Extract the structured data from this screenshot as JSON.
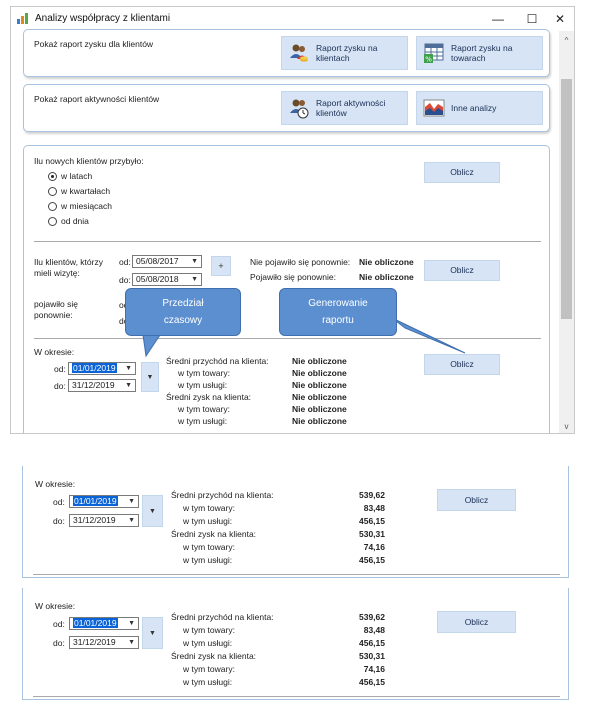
{
  "window": {
    "title": "Analizy współpracy z klientami",
    "min_glyph": "—",
    "max_glyph": "☐",
    "close_glyph": "✕"
  },
  "profit_panel": {
    "label": "Pokaż raport zysku dla klientów",
    "btn_clients_l1": "Raport zysku na",
    "btn_clients_l2": "klientach",
    "btn_goods_l1": "Raport zysku na",
    "btn_goods_l2": "towarach"
  },
  "activity_panel": {
    "label": "Pokaż raport aktywności klientów",
    "btn_activity_l1": "Raport aktywności",
    "btn_activity_l2": "klientów",
    "btn_other": "Inne analizy"
  },
  "new_clients": {
    "question": "Ilu nowych klientów przybyło:",
    "options": [
      "w latach",
      "w kwartałach",
      "w miesiącach",
      "od dnia"
    ],
    "selected_index": 0,
    "calc_label": "Oblicz"
  },
  "visits": {
    "question_l1": "Ilu klientów, którzy",
    "question_l2": "mieli wizytę:",
    "from_label": "od:",
    "from_value": "05/08/2017",
    "to_label": "do:",
    "to_value": "05/08/2018",
    "plus": "+",
    "not_returned_label": "Nie pojawiło się ponownie:",
    "not_returned_value": "Nie obliczone",
    "returned_label": "Pojawiło się ponownie:",
    "returned_value": "Nie obliczone",
    "calc_label": "Oblicz",
    "appeared_l1": "pojawiło się",
    "appeared_l2": "ponownie:",
    "hidden_from_frag": "od",
    "hidden_to_frag": "do"
  },
  "period_top": {
    "label": "W okresie:",
    "from_label": "od:",
    "from_value": "01/01/2019",
    "to_label": "do:",
    "to_value": "31/12/2019",
    "calc_label": "Oblicz",
    "rows": [
      {
        "label": "Średni przychód na klienta:",
        "value": "Nie obliczone"
      },
      {
        "label": "w tym towary:",
        "value": "Nie obliczone"
      },
      {
        "label": "w tym usługi:",
        "value": "Nie obliczone"
      },
      {
        "label": "Średni zysk na klienta:",
        "value": "Nie obliczone"
      },
      {
        "label": "w tym towary:",
        "value": "Nie obliczone"
      },
      {
        "label": "w tym usługi:",
        "value": "Nie obliczone"
      }
    ]
  },
  "callouts": {
    "range_l1": "Przedział",
    "range_l2": "czasowy",
    "gen_l1": "Generowanie",
    "gen_l2": "raportu"
  },
  "period_crop_1": {
    "label": "W okresie:",
    "from_label": "od:",
    "from_value": "01/01/2019",
    "to_label": "do:",
    "to_value": "31/12/2019",
    "calc_label": "Oblicz",
    "rows": [
      {
        "label": "Średni przychód na klienta:",
        "value": "539,62"
      },
      {
        "label": "w tym towary:",
        "value": "83,48"
      },
      {
        "label": "w tym usługi:",
        "value": "456,15"
      },
      {
        "label": "Średni zysk na klienta:",
        "value": "530,31"
      },
      {
        "label": "w tym towary:",
        "value": "74,16"
      },
      {
        "label": "w tym usługi:",
        "value": "456,15"
      }
    ]
  },
  "period_crop_2": {
    "label": "W okresie:",
    "from_label": "od:",
    "from_value": "01/01/2019",
    "to_label": "do:",
    "to_value": "31/12/2019",
    "calc_label": "Oblicz",
    "rows": [
      {
        "label": "Średni przychód na klienta:",
        "value": "539,62"
      },
      {
        "label": "w tym towary:",
        "value": "83,48"
      },
      {
        "label": "w tym usługi:",
        "value": "456,15"
      },
      {
        "label": "Średni zysk na klienta:",
        "value": "530,31"
      },
      {
        "label": "w tym towary:",
        "value": "74,16"
      },
      {
        "label": "w tym usługi:",
        "value": "456,15"
      }
    ]
  },
  "scrollbar": {
    "up_glyph": "^",
    "down_glyph": "v"
  },
  "colors": {
    "accent_button": "#d6e4f5",
    "panel_border": "#a9c3de",
    "callout": "#5b8fd0",
    "selection": "#0a64d8"
  }
}
